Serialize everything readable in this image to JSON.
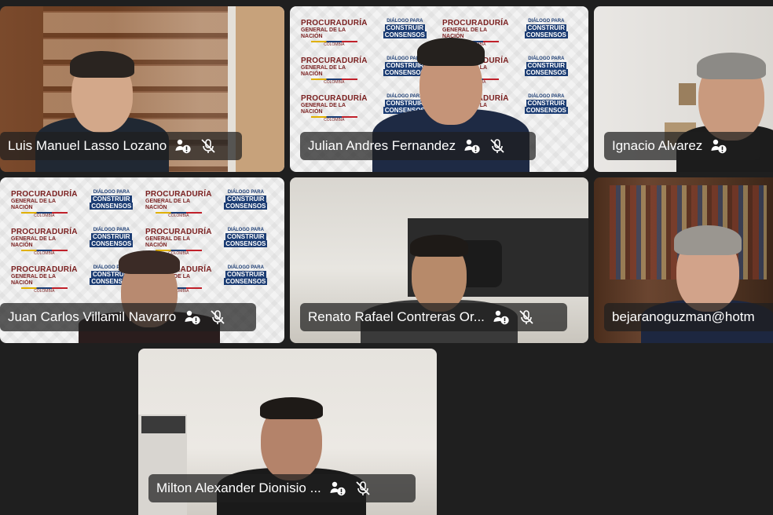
{
  "participants": [
    {
      "name": "Luis Manuel Lasso Lozano"
    },
    {
      "name": "Julian Andres Fernandez"
    },
    {
      "name": "Ignacio Alvarez"
    },
    {
      "name": "Juan Carlos Villamil Navarro"
    },
    {
      "name": "Renato Rafael Contreras Or..."
    },
    {
      "name": "bejaranoguzman@hotm"
    },
    {
      "name": "Milton Alexander Dionisio ..."
    }
  ],
  "branding": {
    "line1": "PROCURADURÍA",
    "line2": "GENERAL DE LA NACIÓN",
    "line3": "COLOMBIA",
    "dialogo1": "DIÁLOGO PARA",
    "dialogo2": "CONSTRUIR",
    "dialogo3": "CONSENSOS"
  },
  "icons": {
    "status": "unstable-connection-icon",
    "mic": "mic-muted-icon"
  }
}
